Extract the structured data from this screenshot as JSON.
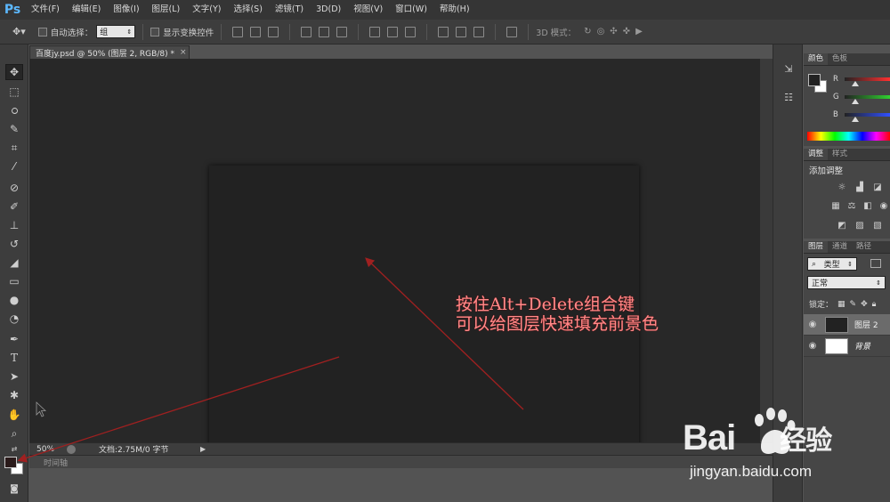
{
  "app": {
    "logo": "Ps",
    "menu": [
      "文件(F)",
      "编辑(E)",
      "图像(I)",
      "图层(L)",
      "文字(Y)",
      "选择(S)",
      "滤镜(T)",
      "3D(D)",
      "视图(V)",
      "窗口(W)",
      "帮助(H)"
    ]
  },
  "options_bar": {
    "auto_select_label": "自动选择：",
    "auto_select_value": "组",
    "show_transform_label": "显示变换控件",
    "mode_3d_label": "3D 模式："
  },
  "document": {
    "tab_title": "百度jy.psd @ 50% (图层 2, RGB/8) *",
    "tab_close": "×",
    "canvas_color": "#222222"
  },
  "status": {
    "zoom": "50%",
    "doc_info": "文档:2.75M/0 字节",
    "timeline_label": "时间轴"
  },
  "color_panel": {
    "tabs": [
      "颜色",
      "色板"
    ],
    "active_tab": 0,
    "foreground": "#222222",
    "background": "#ffffff",
    "channels": [
      {
        "label": "R",
        "color": "#c03030"
      },
      {
        "label": "G",
        "color": "#30a030"
      },
      {
        "label": "B",
        "color": "#3050c0"
      }
    ]
  },
  "adjustments_panel": {
    "tabs": [
      "调整",
      "样式"
    ],
    "active_tab": 0,
    "title": "添加调整"
  },
  "layers_panel": {
    "tabs": [
      "图层",
      "通道",
      "路径"
    ],
    "active_tab": 0,
    "filter_value": "类型",
    "blend_mode": "正常",
    "lock_label": "锁定：",
    "layers": [
      {
        "name": "图层 2",
        "thumb_color": "#222222",
        "selected": true,
        "italic": false
      },
      {
        "name": "背景",
        "thumb_color": "#ffffff",
        "selected": false,
        "italic": true
      }
    ]
  },
  "annotation": {
    "line1": "按住Alt+Delete组合键",
    "line2": "可以给图层快速填充前景色",
    "color": "#ff8a8a"
  },
  "watermark": {
    "brand": "Bai",
    "brand_cn": "经验",
    "url": "jingyan.baidu.com"
  }
}
